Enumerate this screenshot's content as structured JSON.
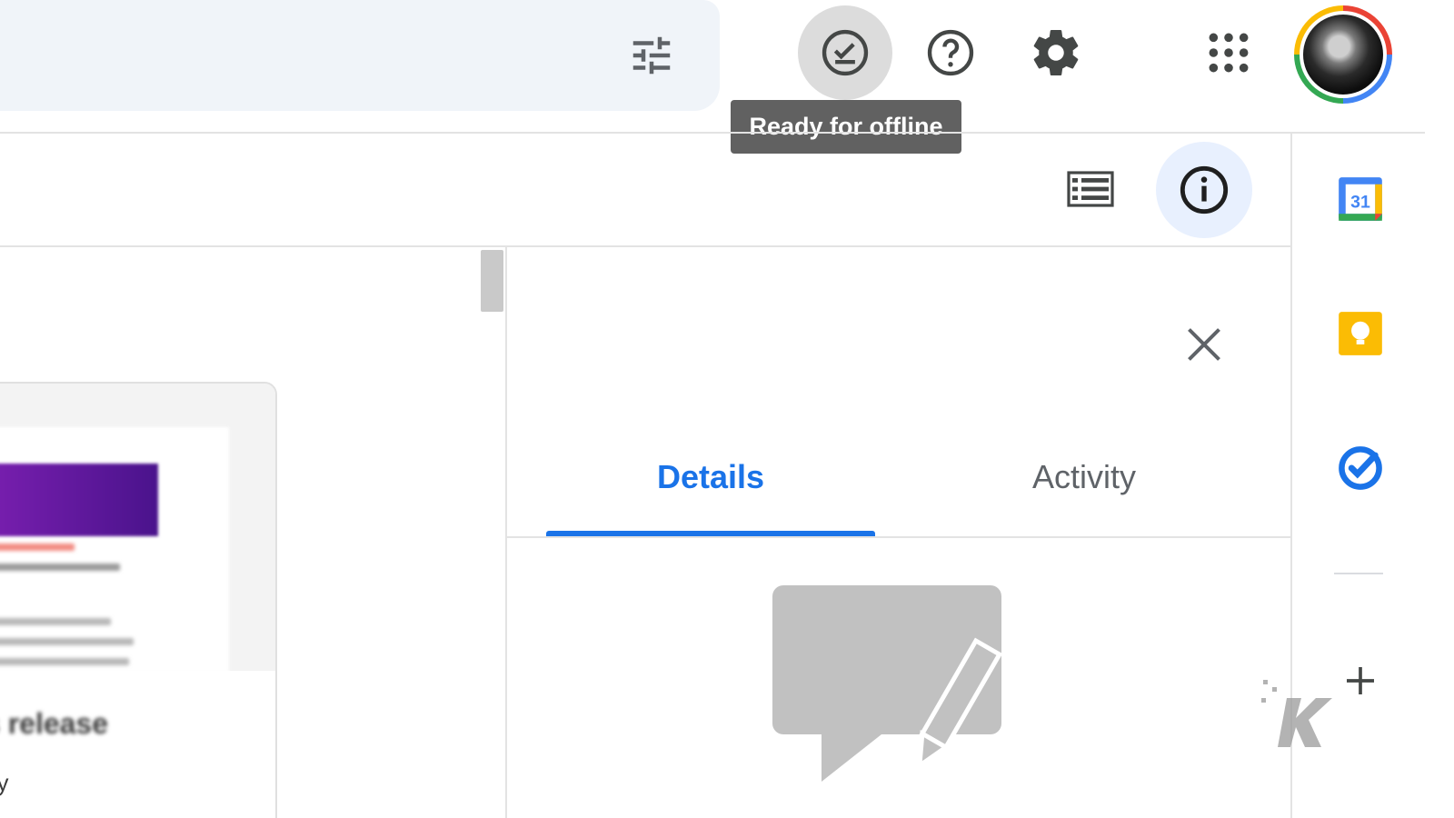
{
  "tooltip": {
    "text": "Ready for offline"
  },
  "tabs": [
    {
      "label": "Details",
      "active": true
    },
    {
      "label": "Activity",
      "active": false
    }
  ],
  "file_card": {
    "title": "s release",
    "subtitle": "ay"
  },
  "side_panel": {
    "calendar_day": "31"
  },
  "colors": {
    "accent": "#1a73e8",
    "tooltip_bg": "#616161",
    "info_button_bg": "#e8f0fe",
    "icon_gray": "#5f6368"
  },
  "icons": [
    "filter-sliders-icon",
    "offline-ready-icon",
    "help-icon",
    "settings-gear-icon",
    "apps-grid-icon",
    "list-view-icon",
    "info-icon",
    "close-icon",
    "calendar-icon",
    "keep-icon",
    "tasks-icon",
    "add-icon"
  ]
}
